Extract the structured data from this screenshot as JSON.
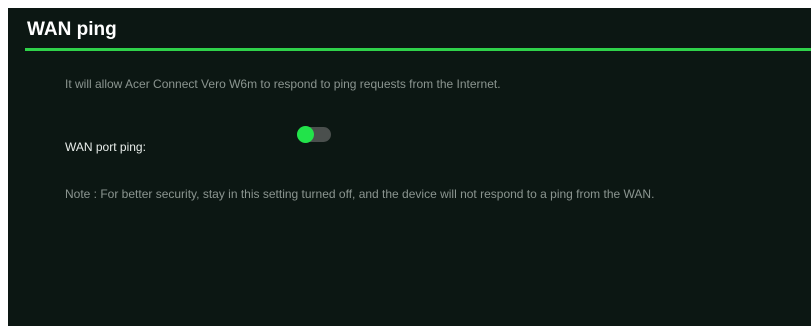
{
  "section": {
    "title": "WAN ping",
    "description": "It will allow Acer Connect Vero W6m to respond to ping requests from the Internet.",
    "note": "Note : For better security, stay in this setting turned off, and the device will not respond to a ping from the WAN."
  },
  "wan_port_ping": {
    "label": "WAN port ping:",
    "toggle_state": "on"
  },
  "colors": {
    "panel_background": "#0c1713",
    "accent_green": "#2fd24a",
    "toggle_knob": "#22e34a",
    "toggle_track": "#4a4f4d"
  }
}
